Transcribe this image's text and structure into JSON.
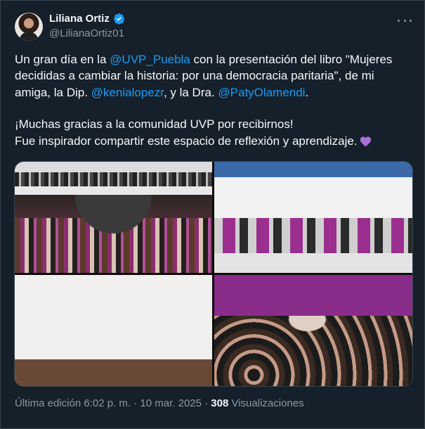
{
  "tweet": {
    "author_name": "Liliana Ortiz",
    "author_handle": "@LilianaOrtiz01",
    "text": {
      "p1_a": "Un gran día en la ",
      "mention_1": "@UVP_Puebla",
      "p1_b": " con la presentación del libro \"Mujeres decididas a cambiar la historia: por una democracia paritaria\", de mi amiga, la Dip. ",
      "mention_2": "@kenialopezr",
      "p1_c": ", y la Dra. ",
      "mention_3": "@PatyOlamendi",
      "p1_d": ".",
      "p2_line1": "¡Muchas gracias a la comunidad UVP por recibirnos!",
      "p2_line2": "Fue inspirador compartir este espacio de reflexión y aprendizaje."
    },
    "emoji": "purple-heart",
    "footer": {
      "edited": "Última edición 6:02 p. m. · 10 mar. 2025 · ",
      "views_count": "308",
      "views_label": " Visualizaciones"
    }
  },
  "colors": {
    "background": "#15202b",
    "link": "#1d9bf0",
    "verified": "#1d9bf0",
    "muted": "#8b98a5",
    "heart": "#a970d6"
  },
  "icons": [
    "verified-badge-icon",
    "more-options-icon",
    "purple-heart-icon"
  ]
}
